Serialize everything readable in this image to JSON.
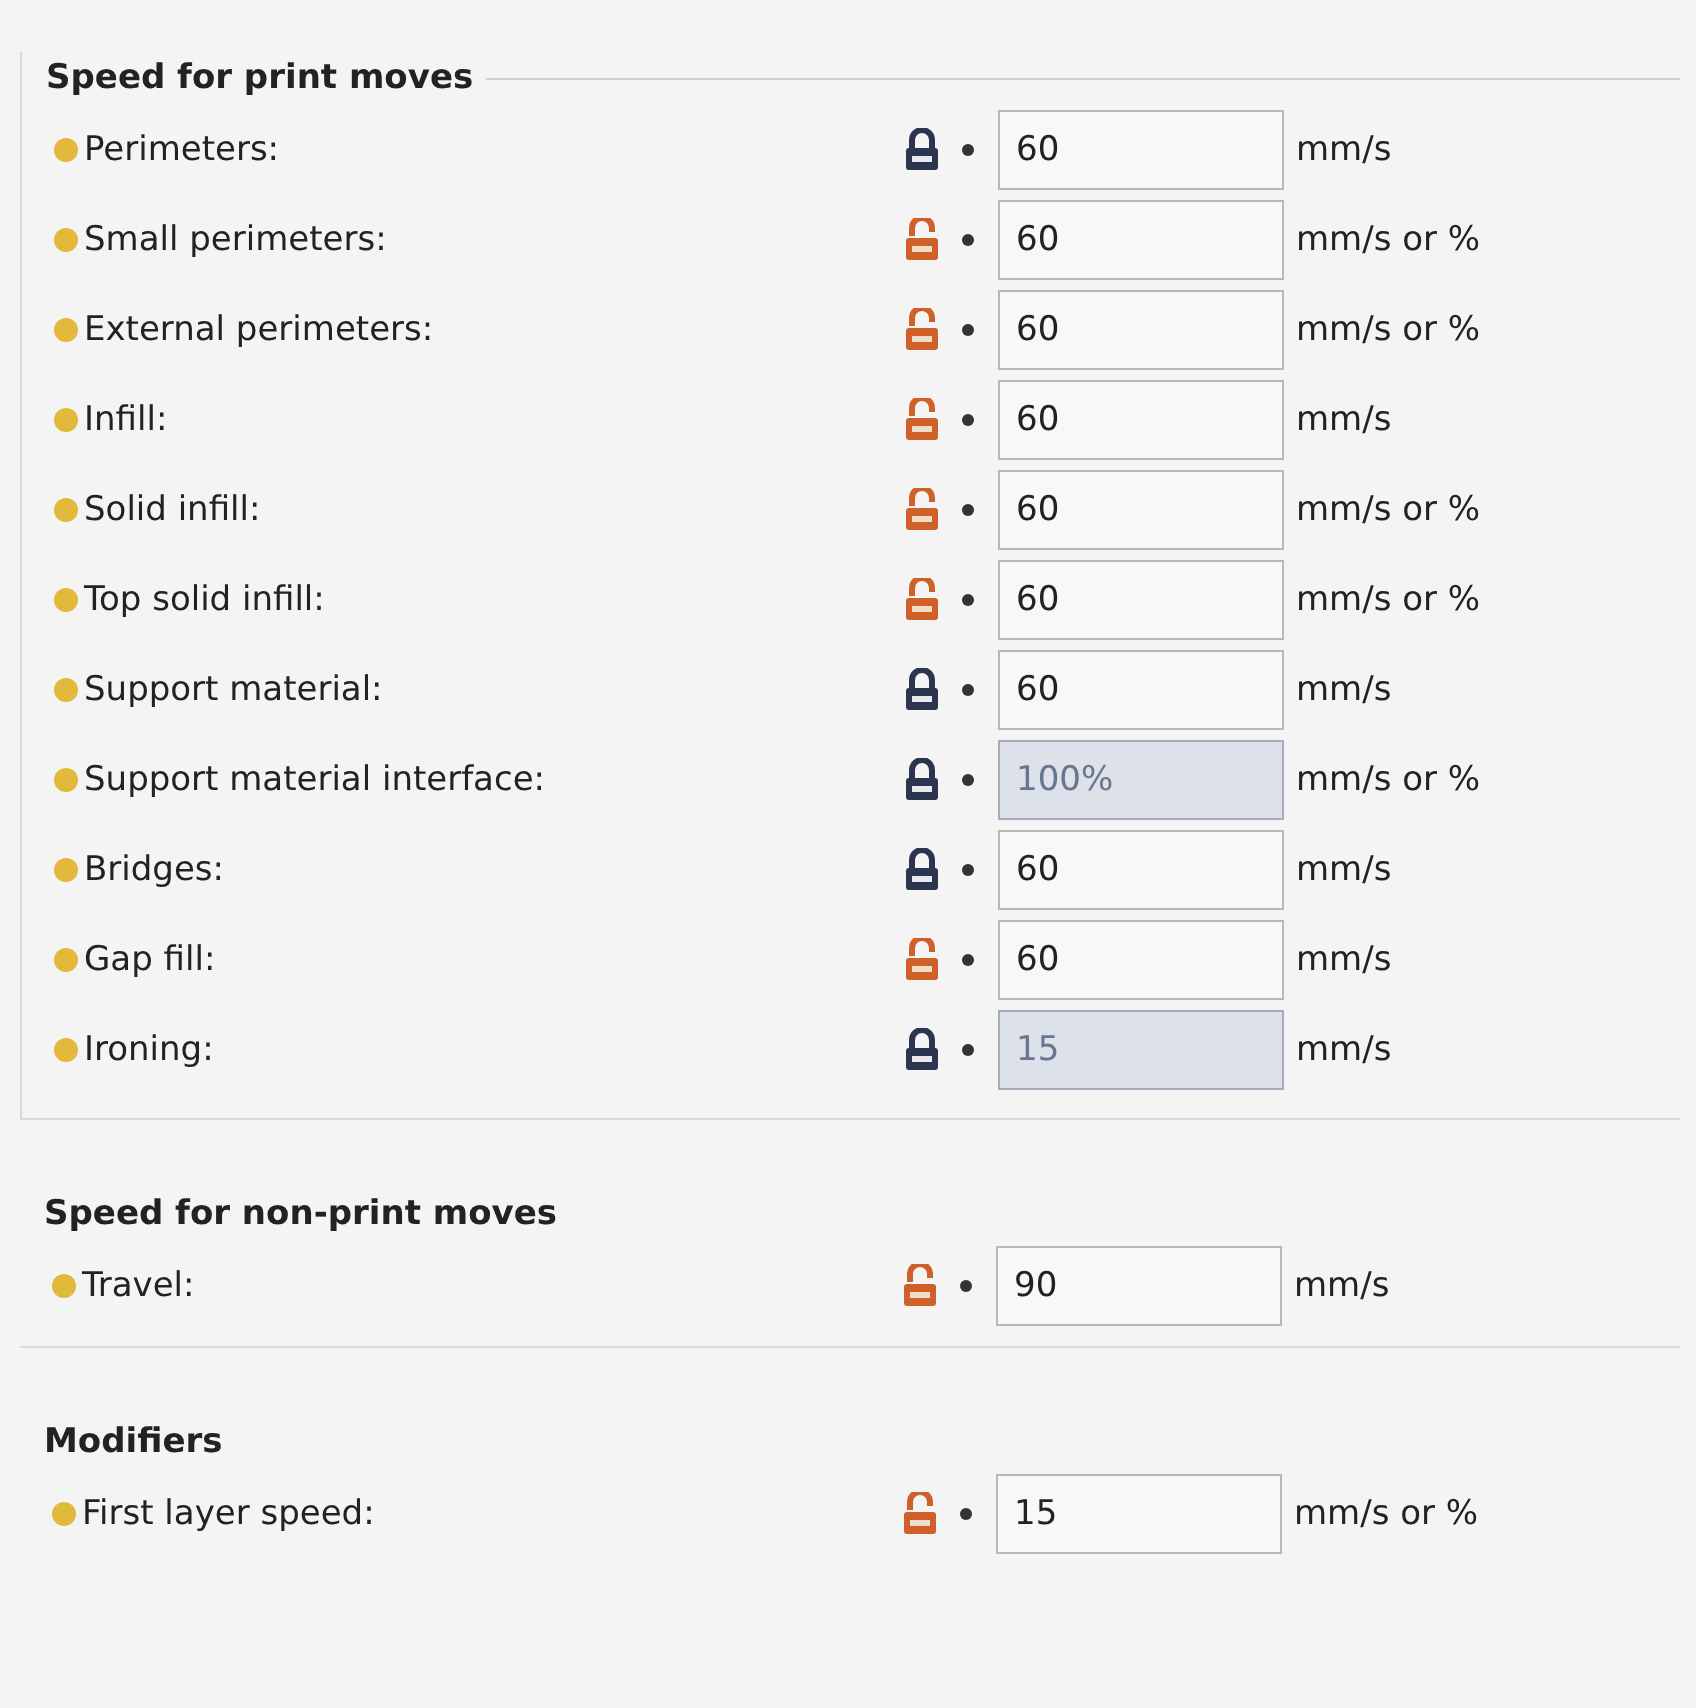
{
  "sections": [
    {
      "title": "Speed for print moves",
      "rows": [
        {
          "label": "Perimeters:",
          "locked": true,
          "value": "60",
          "unit": "mm/s",
          "disabled": false
        },
        {
          "label": "Small perimeters:",
          "locked": false,
          "value": "60",
          "unit": "mm/s or %",
          "disabled": false
        },
        {
          "label": "External perimeters:",
          "locked": false,
          "value": "60",
          "unit": "mm/s or %",
          "disabled": false
        },
        {
          "label": "Infill:",
          "locked": false,
          "value": "60",
          "unit": "mm/s",
          "disabled": false
        },
        {
          "label": "Solid infill:",
          "locked": false,
          "value": "60",
          "unit": "mm/s or %",
          "disabled": false
        },
        {
          "label": "Top solid infill:",
          "locked": false,
          "value": "60",
          "unit": "mm/s or %",
          "disabled": false
        },
        {
          "label": "Support material:",
          "locked": true,
          "value": "60",
          "unit": "mm/s",
          "disabled": false
        },
        {
          "label": "Support material interface:",
          "locked": true,
          "value": "100%",
          "unit": "mm/s or %",
          "disabled": true
        },
        {
          "label": "Bridges:",
          "locked": true,
          "value": "60",
          "unit": "mm/s",
          "disabled": false
        },
        {
          "label": "Gap fill:",
          "locked": false,
          "value": "60",
          "unit": "mm/s",
          "disabled": false
        },
        {
          "label": "Ironing:",
          "locked": true,
          "value": "15",
          "unit": "mm/s",
          "disabled": true
        }
      ]
    },
    {
      "title": "Speed for non-print moves",
      "rows": [
        {
          "label": "Travel:",
          "locked": false,
          "value": "90",
          "unit": "mm/s",
          "disabled": false
        }
      ]
    },
    {
      "title": "Modifiers",
      "rows": [
        {
          "label": "First layer speed:",
          "locked": false,
          "value": "15",
          "unit": "mm/s or %",
          "disabled": false
        }
      ]
    }
  ]
}
